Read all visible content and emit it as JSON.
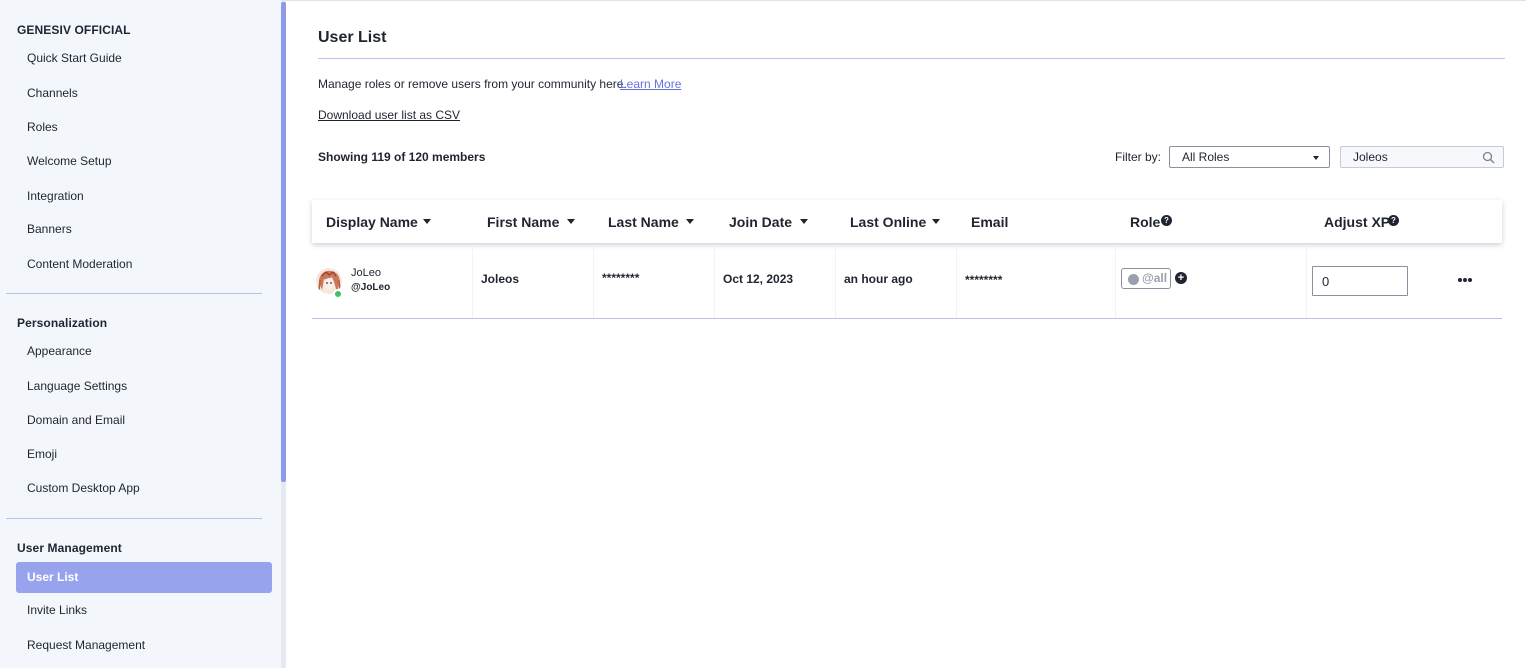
{
  "sidebar": {
    "sections": [
      {
        "title": "GENESIV OFFICIAL",
        "items": [
          "Quick Start Guide",
          "Channels",
          "Roles",
          "Welcome Setup",
          "Integration",
          "Banners",
          "Content Moderation"
        ]
      },
      {
        "title": "Personalization",
        "items": [
          "Appearance",
          "Language Settings",
          "Domain and Email",
          "Emoji",
          "Custom Desktop App"
        ]
      },
      {
        "title": "User Management",
        "items": [
          "User List",
          "Invite Links",
          "Request Management"
        ]
      }
    ],
    "active_item": "User List"
  },
  "main": {
    "title": "User List",
    "intro_text": "Manage roles or remove users from your community here.",
    "learn_more": "Learn More",
    "download_csv": "Download user list as CSV",
    "showing": "Showing 119 of 120 members",
    "filter_label": "Filter by:",
    "role_filter_value": "All Roles",
    "search_value": "Joleos"
  },
  "table": {
    "headers": {
      "display_name": "Display Name",
      "first_name": "First Name",
      "last_name": "Last Name",
      "join_date": "Join Date",
      "last_online": "Last Online",
      "email": "Email",
      "role": "Role",
      "adjust_xp": "Adjust XP"
    },
    "rows": [
      {
        "display_name": "JoLeo",
        "username": "@JoLeo",
        "first_name": "Joleos",
        "last_name": "********",
        "join_date": "Oct 12, 2023",
        "last_online": "an hour ago",
        "email": "********",
        "role": "@all",
        "xp": "0",
        "online": true
      }
    ]
  },
  "colors": {
    "accent": "#97a3ec",
    "link": "#6472e0",
    "online": "#3fbf6a",
    "text": "#1f2430"
  },
  "icons": {
    "search": "search-icon",
    "help": "help-icon",
    "add": "plus-circle-icon",
    "more": "more-horizontal-icon",
    "sort": "caret-down-icon"
  }
}
